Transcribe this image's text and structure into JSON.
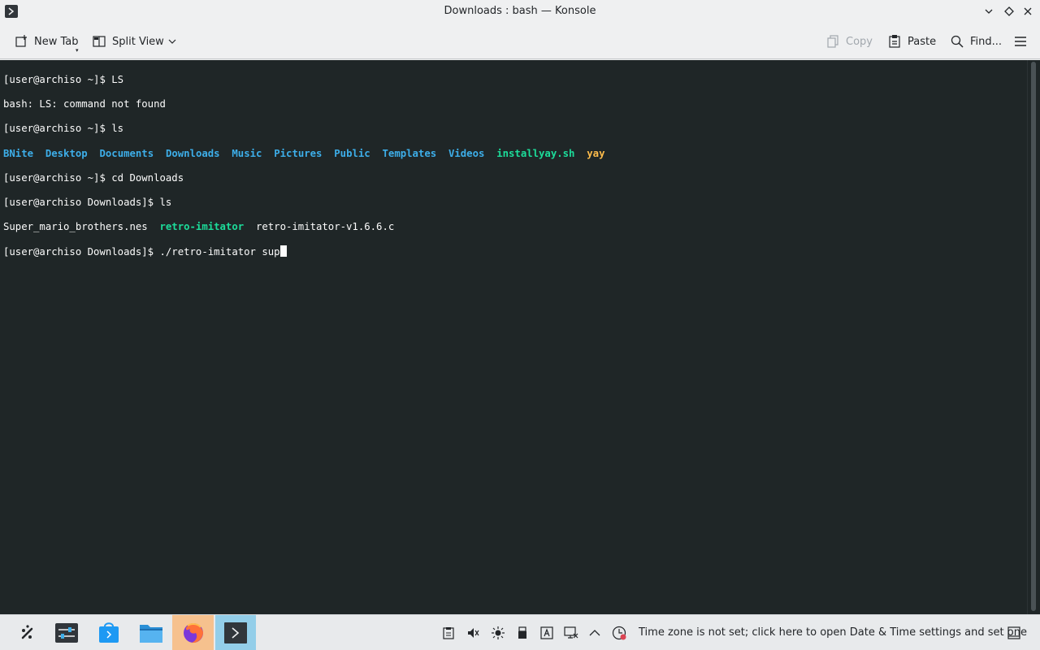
{
  "window": {
    "title": "Downloads : bash — Konsole"
  },
  "toolbar": {
    "new_tab_label": "New Tab",
    "split_view_label": "Split View",
    "copy_label": "Copy",
    "paste_label": "Paste",
    "find_label": "Find..."
  },
  "terminal": {
    "lines": {
      "l1": "[user@archiso ~]$ LS",
      "l2": "bash: LS: command not found",
      "l3": "[user@archiso ~]$ ls",
      "l5": "[user@archiso ~]$ cd Downloads",
      "l6": "[user@archiso Downloads]$ ls",
      "l8_prompt": "[user@archiso Downloads]$ ",
      "l8_input": "./retro-imitator sup"
    },
    "home_listing": {
      "d1": "BNite",
      "d2": "Desktop",
      "d3": "Documents",
      "d4": "Downloads",
      "d5": "Music",
      "d6": "Pictures",
      "d7": "Public",
      "d8": "Templates",
      "d9": "Videos",
      "f1": "installyay.sh",
      "f2": "yay"
    },
    "downloads_listing": {
      "f1": "Super_mario_brothers.nes",
      "f2": "retro-imitator",
      "f3": "retro-imitator-v1.6.6.c"
    },
    "colors": {
      "background": "#1f2627",
      "foreground": "#fcfcfc",
      "directory": "#3daee9",
      "executable": "#1cdc9a",
      "special": "#fdbc4b"
    }
  },
  "taskbar": {
    "tray_message": "Time zone is not set; click here to open Date & Time settings and set one",
    "apps": [
      "application-launcher-icon",
      "system-settings-icon",
      "discover-icon",
      "file-manager-icon",
      "firefox-icon",
      "konsole-icon"
    ]
  }
}
